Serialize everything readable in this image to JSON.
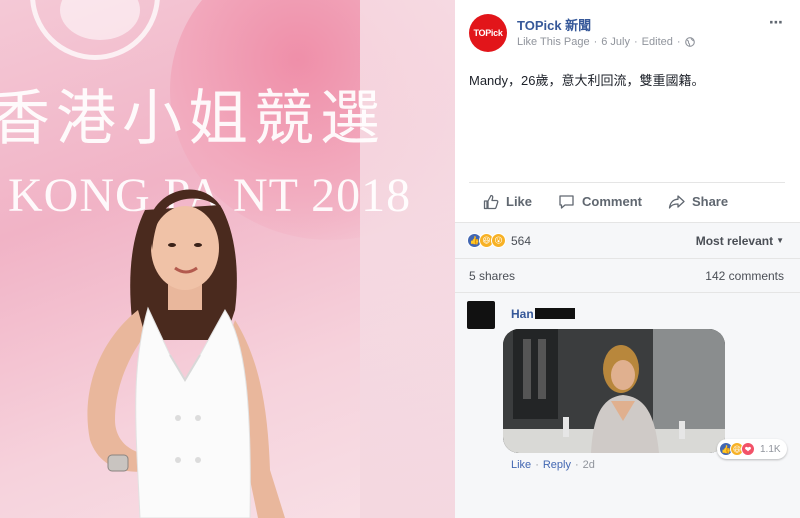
{
  "post": {
    "page_name": "TOPick 新聞",
    "avatar_text": "TOPick",
    "like_page": "Like This Page",
    "dot": "·",
    "date": "6 July",
    "edited": "Edited",
    "text": "Mandy，26歲，意大利回流，雙重國籍。",
    "more_icon": "⋯"
  },
  "photo": {
    "zh_title": "香港小姐競選",
    "en_title": "KONG PA      NT 2018"
  },
  "actions": {
    "like": "Like",
    "comment": "Comment",
    "share": "Share"
  },
  "reactions": {
    "count": "564",
    "sort_label": "Most relevant",
    "icons": [
      "like-icon",
      "haha-icon",
      "wow-icon"
    ]
  },
  "stats": {
    "shares": "5 shares",
    "comments": "142 comments"
  },
  "comment": {
    "name": "Han",
    "reaction_count": "1.1K",
    "like": "Like",
    "reply": "Reply",
    "time": "2d",
    "reaction_icons": [
      "like-icon",
      "haha-icon",
      "love-icon"
    ]
  },
  "colors": {
    "facebook_blue": "#365899",
    "brand_red": "#e2151a",
    "meta_gray": "#90949c"
  }
}
